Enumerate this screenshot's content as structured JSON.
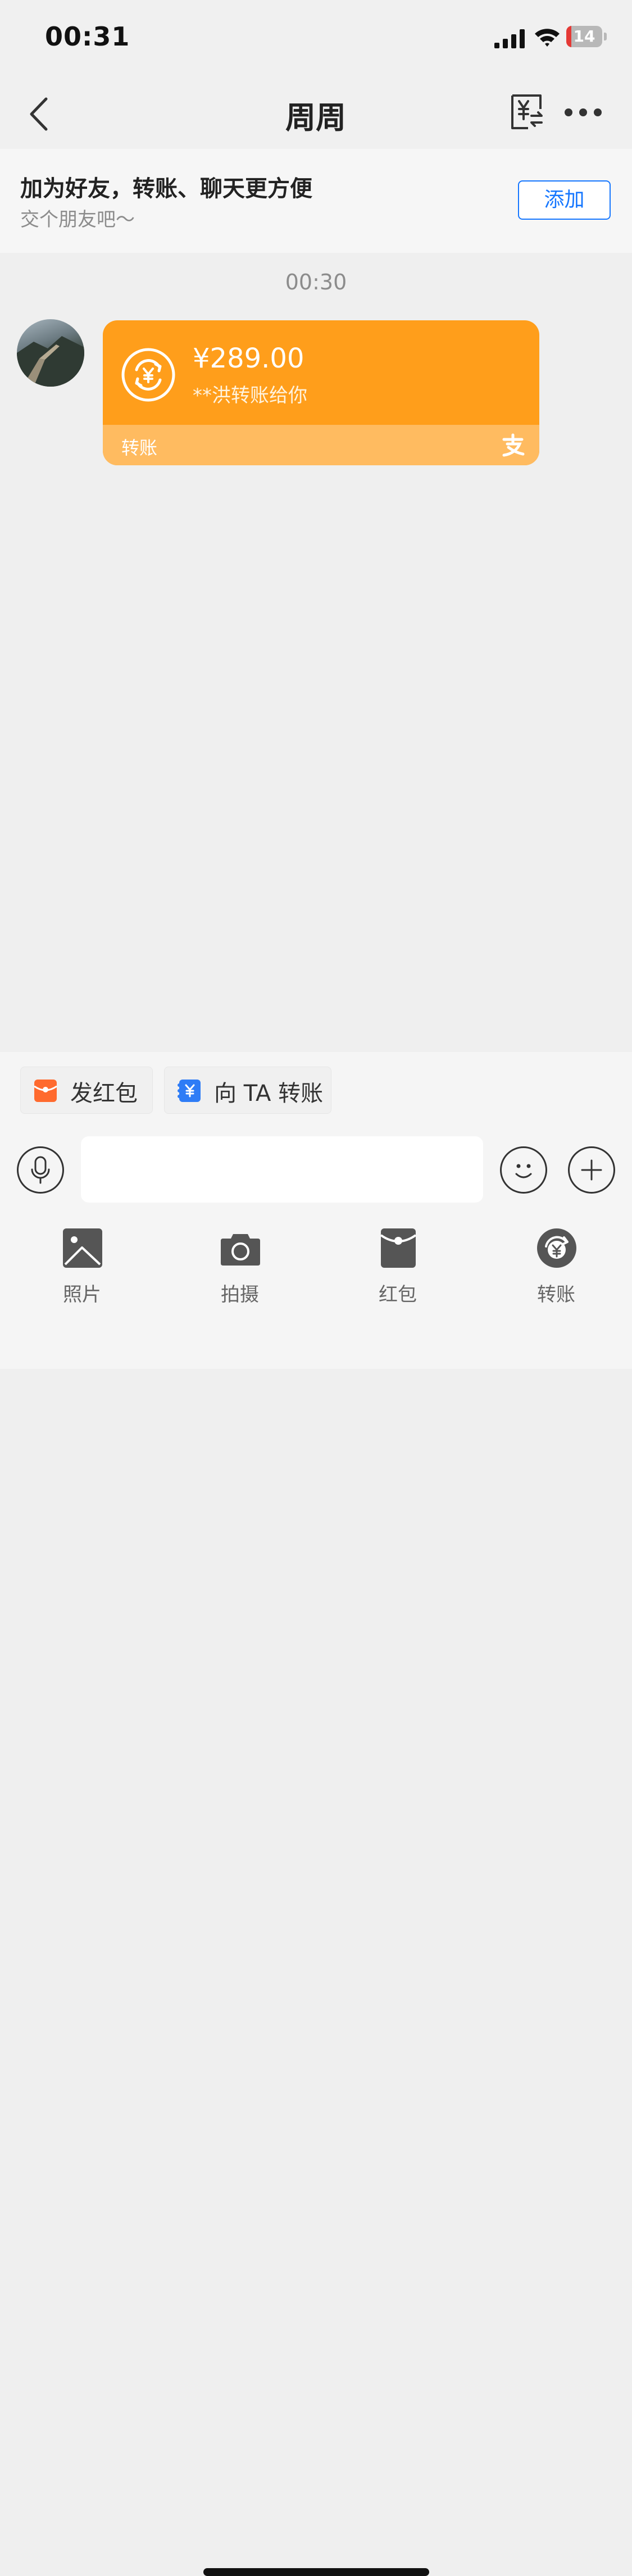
{
  "status_bar": {
    "time": "00:31",
    "battery": "14",
    "battery_level": 0.14
  },
  "nav": {
    "title": "周周"
  },
  "banner": {
    "title": "加为好友，转账、聊天更方便",
    "subtitle": "交个朋友吧～",
    "add_label": "添加"
  },
  "chat": {
    "time": "00:30",
    "transfer_card": {
      "amount": "¥289.00",
      "description": "**洪转账给你",
      "footer_label": "转账"
    }
  },
  "quick_actions": [
    {
      "label": "发红包",
      "icon": "red-packet-icon"
    },
    {
      "label": "向 TA 转账",
      "icon": "transfer-icon"
    }
  ],
  "input": {
    "value": "",
    "placeholder": ""
  },
  "toolbar": [
    {
      "label": "照片",
      "icon": "photo-icon"
    },
    {
      "label": "拍摄",
      "icon": "camera-icon"
    },
    {
      "label": "红包",
      "icon": "red-packet-icon"
    },
    {
      "label": "转账",
      "icon": "transfer-icon"
    }
  ],
  "colors": {
    "card": "#ff9e1b",
    "card_footer": "#ffbb60",
    "link_blue": "#1677ff",
    "red_packet": "#ff6a2e",
    "transfer_blue": "#2e7cf6"
  }
}
